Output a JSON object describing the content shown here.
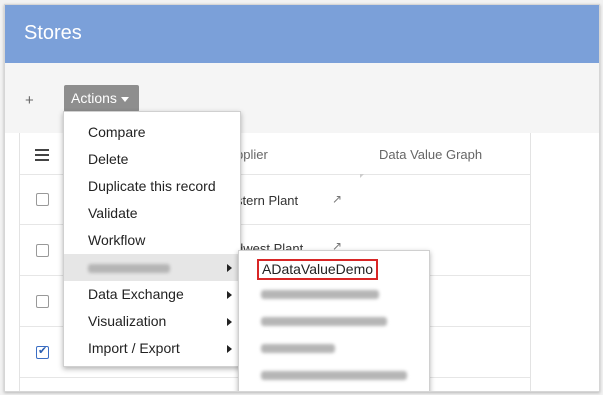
{
  "header": {
    "title": "Stores"
  },
  "toolbar": {
    "add_label": "+",
    "actions_label": "Actions"
  },
  "table": {
    "columns": [
      "pplier",
      "Data Value Graph"
    ],
    "rows": [
      {
        "checked": false,
        "supplier": "stern Plant"
      },
      {
        "checked": false,
        "supplier": "dwest Plant"
      },
      {
        "checked": false,
        "supplier": ""
      },
      {
        "checked": true,
        "supplier": ""
      }
    ]
  },
  "actions_menu": {
    "items": [
      {
        "label": "Compare",
        "submenu": false
      },
      {
        "label": "Delete",
        "submenu": false
      },
      {
        "label": "Duplicate this record",
        "submenu": false
      },
      {
        "label": "Validate",
        "submenu": false
      },
      {
        "label": "Workflow",
        "submenu": false
      },
      {
        "label": "",
        "submenu": true,
        "highlighted": true,
        "redacted": true
      },
      {
        "label": "Data Exchange",
        "submenu": true
      },
      {
        "label": "Visualization",
        "submenu": true
      },
      {
        "label": "Import / Export",
        "submenu": true
      }
    ]
  },
  "submenu": {
    "items": [
      {
        "label": "ADataValueDemo",
        "boxed": true
      },
      {
        "label": "",
        "redacted": true
      },
      {
        "label": "",
        "redacted": true
      },
      {
        "label": "",
        "redacted": true
      },
      {
        "label": "",
        "redacted": true
      }
    ]
  },
  "colors": {
    "header": "#7ba0d9",
    "actions_button": "#8e8e8e",
    "highlight_box": "#d82626"
  },
  "icons": {
    "menu": "hamburger-icon",
    "external": "external-link-icon",
    "submenu": "chevron-right-icon"
  }
}
